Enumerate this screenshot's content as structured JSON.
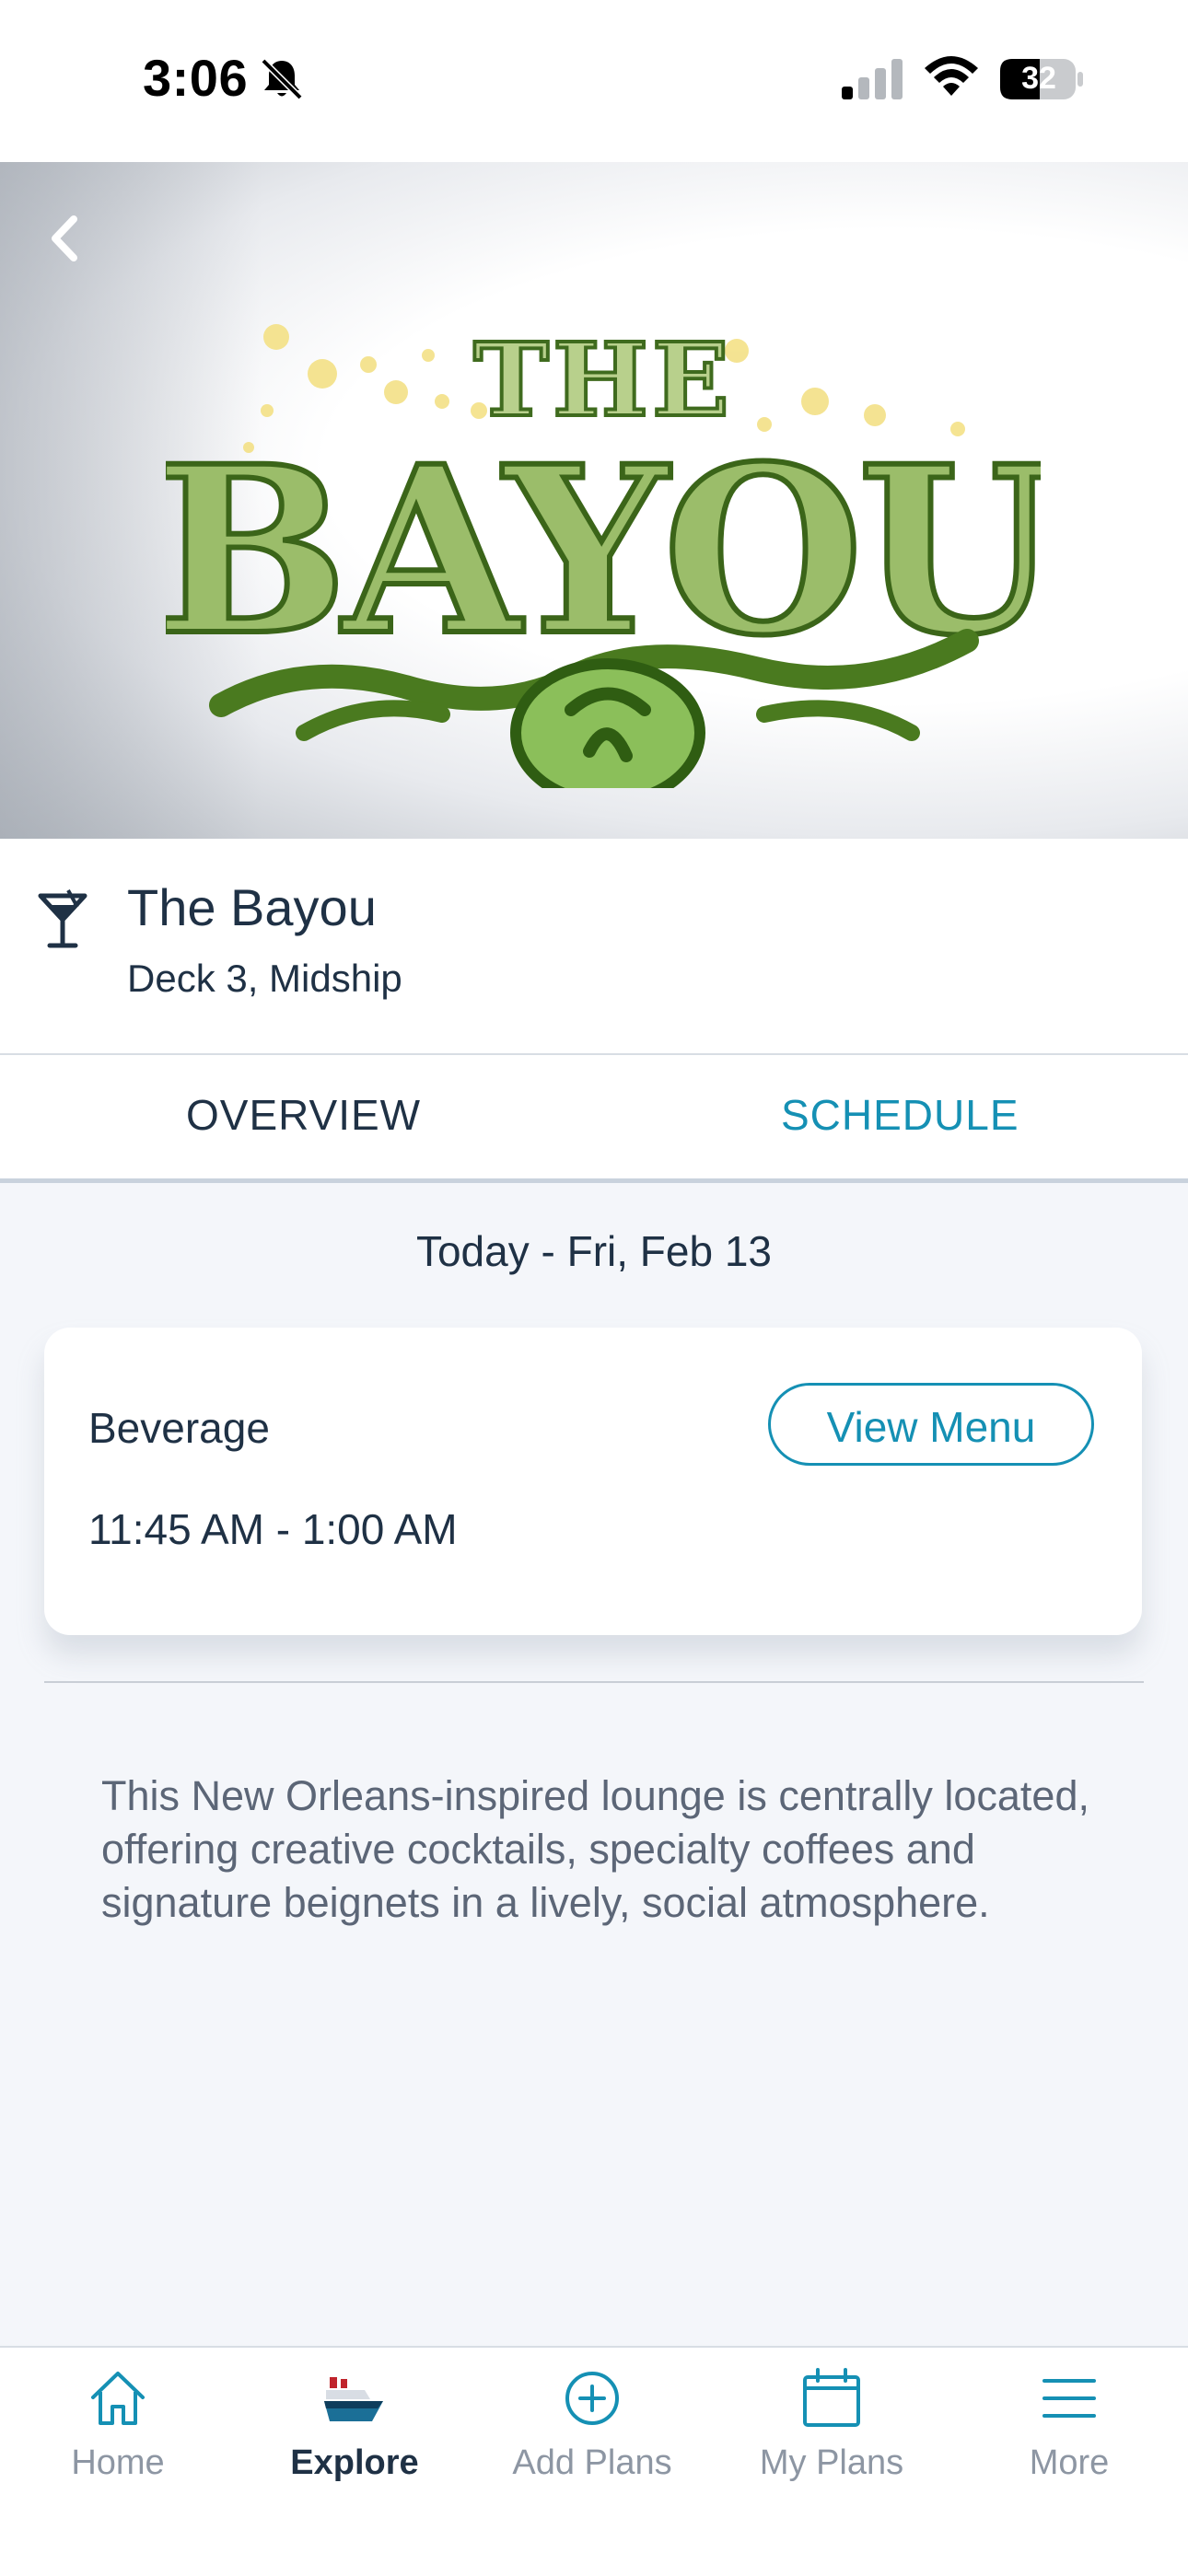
{
  "status_bar": {
    "time": "3:06",
    "battery": "32"
  },
  "hero": {
    "logo_text_top": "THE",
    "logo_text_main": "BAYOU"
  },
  "venue": {
    "name": "The Bayou",
    "location": "Deck 3, Midship"
  },
  "tabs": [
    {
      "label": "OVERVIEW",
      "active": false
    },
    {
      "label": "SCHEDULE",
      "active": true
    }
  ],
  "schedule": {
    "date": "Today - Fri, Feb 13",
    "entries": [
      {
        "type": "Beverage",
        "hours": "11:45 AM - 1:00 AM",
        "button": "View Menu"
      }
    ]
  },
  "description": "This New Orleans-inspired lounge is centrally located, offering creative cocktails, specialty coffees and signature beignets in a lively, social atmosphere.",
  "nav": [
    {
      "label": "Home",
      "icon": "home-icon"
    },
    {
      "label": "Explore",
      "icon": "ship-icon",
      "active": true
    },
    {
      "label": "Add Plans",
      "icon": "plus-circle-icon"
    },
    {
      "label": "My Plans",
      "icon": "calendar-icon"
    },
    {
      "label": "More",
      "icon": "menu-icon"
    }
  ],
  "colors": {
    "accent": "#1590b4",
    "text_dark": "#1f3145",
    "text_muted": "#5c6677",
    "background": "#f4f6fa",
    "logo_green": "#4e7a2a"
  }
}
